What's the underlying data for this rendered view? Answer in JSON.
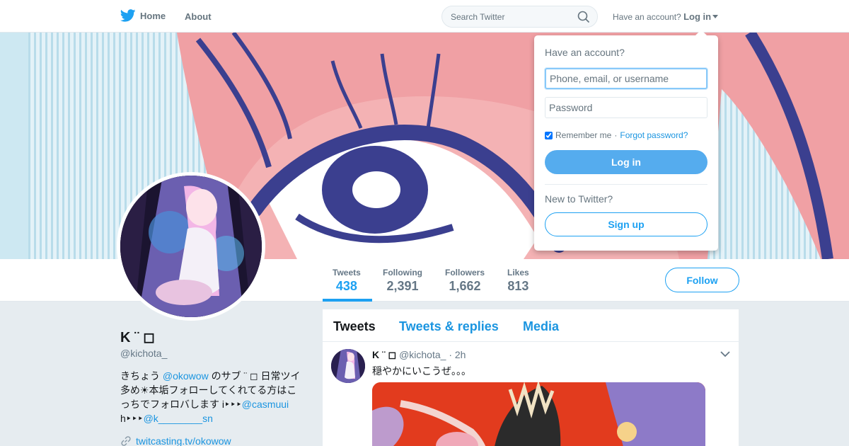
{
  "nav": {
    "home_label": "Home",
    "about_label": "About",
    "search_placeholder": "Search Twitter",
    "have_account": "Have an account?",
    "login_label": "Log in"
  },
  "profile": {
    "name": "K ¨ ◻︎",
    "handle": "@kichota_",
    "bio": {
      "part1": "きちょう ",
      "mention1": "@okowow",
      "part2": " のサブ ¨ ◻︎ 日常ツイ多め☀︎本垢フォローしてくれてる方はこっちでフォロバします i‣‣‣",
      "mention2": "@casmuui",
      "part3": " h‣‣‣",
      "mention3": "@k________sn"
    },
    "link": "twitcasting.tv/okowow",
    "follow_label": "Follow"
  },
  "stats": [
    {
      "label": "Tweets",
      "value": "438"
    },
    {
      "label": "Following",
      "value": "2,391"
    },
    {
      "label": "Followers",
      "value": "1,662"
    },
    {
      "label": "Likes",
      "value": "813"
    }
  ],
  "tabs": [
    "Tweets",
    "Tweets & replies",
    "Media"
  ],
  "tweet": {
    "name": "K ¨ ◻︎",
    "handle": "@kichota_",
    "time": "· 2h",
    "text": "穏やかにいこうぜ。。。"
  },
  "login_dropdown": {
    "title": "Have an account?",
    "username_placeholder": "Phone, email, or username",
    "password_placeholder": "Password",
    "remember": "Remember me",
    "separator": "·",
    "forgot": "Forgot password?",
    "login_button": "Log in",
    "new_to_twitter": "New to Twitter?",
    "signup_button": "Sign up"
  },
  "colors": {
    "accent": "#1da1f2",
    "link": "#1b95e0",
    "login_button": "#55acee"
  }
}
